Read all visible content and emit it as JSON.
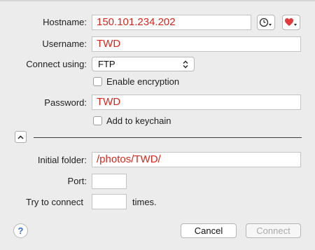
{
  "form": {
    "hostname": {
      "label": "Hostname:",
      "value": "150.101.234.202"
    },
    "username": {
      "label": "Username:",
      "value": "TWD"
    },
    "connect_using": {
      "label": "Connect using:",
      "value": "FTP"
    },
    "enable_encryption": {
      "label": "Enable encryption",
      "checked": false
    },
    "password": {
      "label": "Password:",
      "value": "TWD"
    },
    "add_to_keychain": {
      "label": "Add to keychain",
      "checked": false
    },
    "initial_folder": {
      "label": "Initial folder:",
      "value": "/photos/TWD/"
    },
    "port": {
      "label": "Port:",
      "value": ""
    },
    "retry": {
      "label": "Try to connect",
      "value": "",
      "suffix": "times."
    }
  },
  "icons": {
    "history": "clock-icon",
    "favorites": "heart-icon",
    "disclosure": "chevron-up-icon",
    "help": "question-mark-icon"
  },
  "help_label": "?",
  "buttons": {
    "cancel": "Cancel",
    "connect": "Connect"
  },
  "colors": {
    "field_text": "#d9261c",
    "help_accent": "#2d6fd6",
    "heart": "#e23a3a"
  }
}
